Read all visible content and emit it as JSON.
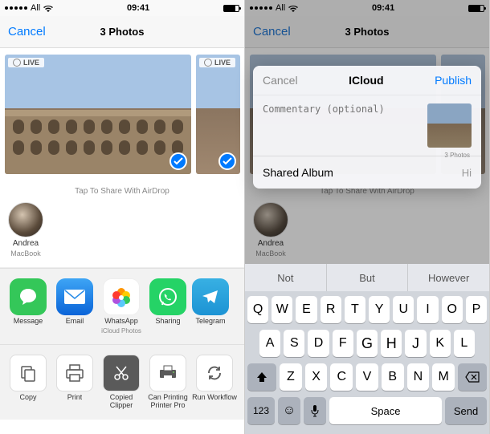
{
  "status": {
    "carrier": "All",
    "time": "09:41",
    "battery_pct": 70
  },
  "nav": {
    "cancel": "Cancel",
    "title": "3 Photos"
  },
  "photos": {
    "live_badge": "LIVE",
    "airdrop_hint": "Tap To Share With AirDrop"
  },
  "airdrop": {
    "name": "Andrea",
    "device": "MacBook"
  },
  "apps": [
    {
      "label": "Message",
      "sublabel": "",
      "color": "#34c759",
      "icon": "message"
    },
    {
      "label": "Email",
      "sublabel": "",
      "color": "#007aff",
      "icon": "email"
    },
    {
      "label": "WhatsApp",
      "sublabel": "iCloud Photos",
      "color": "gradient",
      "icon": "photos"
    },
    {
      "label": "Sharing",
      "sublabel": "",
      "color": "#25d366",
      "icon": "whatsapp"
    },
    {
      "label": "Telegram",
      "sublabel": "",
      "color": "#2aabee",
      "icon": "telegram"
    }
  ],
  "actions": [
    {
      "label": "Copy",
      "icon": "copy"
    },
    {
      "label": "Print",
      "icon": "print"
    },
    {
      "label": "Copied Clipper",
      "icon": "clipper"
    },
    {
      "label": "Can Printing Printer Pro",
      "icon": "printerpro"
    },
    {
      "label": "Run Workflow",
      "icon": "workflow"
    }
  ],
  "modal": {
    "cancel": "Cancel",
    "title": "ICloud",
    "publish": "Publish",
    "commentary_placeholder": "Commentary (optional)",
    "thumb_count": "3 Photos",
    "shared_album_label": "Shared Album",
    "shared_album_value": "Hi"
  },
  "keyboard": {
    "suggestions": [
      "Not",
      "But",
      "However"
    ],
    "row1": [
      "Q",
      "W",
      "E",
      "R",
      "T",
      "Y",
      "U",
      "I",
      "O",
      "P"
    ],
    "row2": [
      "A",
      "S",
      "D",
      "F",
      "G",
      "H",
      "J",
      "K",
      "L"
    ],
    "row3": [
      "Z",
      "X",
      "C",
      "V",
      "B",
      "N",
      "M"
    ],
    "num_key": "123",
    "space": "Space",
    "send": "Send"
  }
}
